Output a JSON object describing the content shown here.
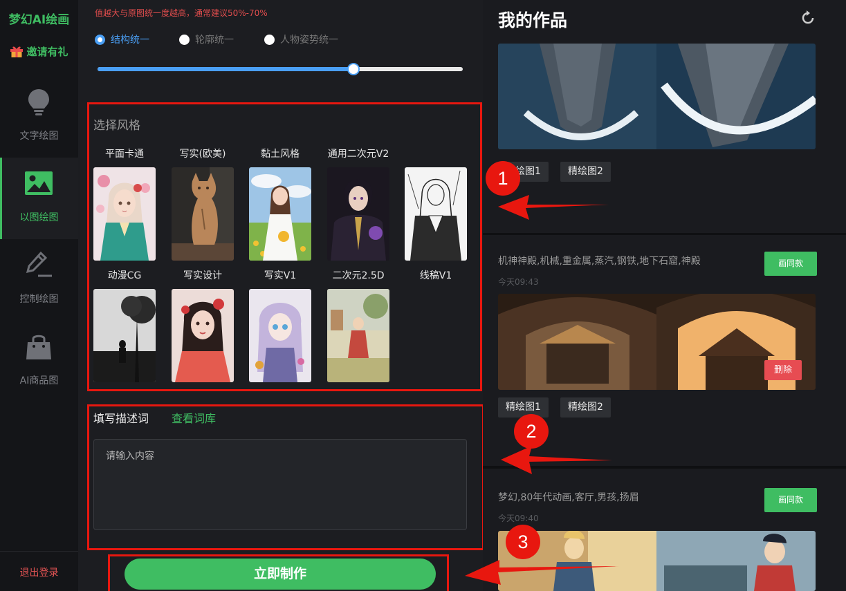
{
  "app": {
    "logo": "梦幻AI绘画",
    "invite": "邀请有礼",
    "logout": "退出登录"
  },
  "nav": [
    {
      "label": "文字绘图",
      "icon": "lightbulb-icon",
      "active": false
    },
    {
      "label": "以图绘图",
      "icon": "image-icon",
      "active": true
    },
    {
      "label": "控制绘图",
      "icon": "pencil-icon",
      "active": false
    },
    {
      "label": "AI商品图",
      "icon": "shopping-bag-icon",
      "active": false
    }
  ],
  "settings": {
    "hint": "值越大与原图统一度越高，通常建议50%-70%",
    "modes": [
      {
        "label": "结构统一",
        "selected": true
      },
      {
        "label": "轮廓统一",
        "selected": false
      },
      {
        "label": "人物姿势统一",
        "selected": false
      }
    ],
    "slider_value_percent": 70
  },
  "styles": {
    "title": "选择风格",
    "items": [
      {
        "name": "平面卡通"
      },
      {
        "name": "写实(欧美)"
      },
      {
        "name": "黏土风格"
      },
      {
        "name": "通用二次元V2"
      },
      {
        "name": "动漫CG"
      },
      {
        "name": "写实设计"
      },
      {
        "name": "写实V1"
      },
      {
        "name": "二次元2.5D"
      },
      {
        "name": "线稿V1"
      }
    ]
  },
  "description": {
    "title": "填写描述词",
    "link": "查看词库",
    "placeholder": "请输入内容"
  },
  "make_button": "立即制作",
  "works": {
    "title": "我的作品",
    "cards": [
      {
        "tags": [
          "精绘图1",
          "精绘图2"
        ]
      },
      {
        "prompt": "机神神殿,机械,重金属,蒸汽,钢铁,地下石窟,神殿",
        "time": "今天09:43",
        "same": "画同款",
        "delete": "删除",
        "tags": [
          "精绘图1",
          "精绘图2"
        ]
      },
      {
        "prompt": "梦幻,80年代动画,客厅,男孩,扬眉",
        "time": "今天09:40",
        "same": "画同款"
      }
    ]
  },
  "annotations": [
    "1",
    "2",
    "3"
  ],
  "colors": {
    "accent": "#3fbd62",
    "blue": "#4a9ff5",
    "red": "#e8170f"
  }
}
